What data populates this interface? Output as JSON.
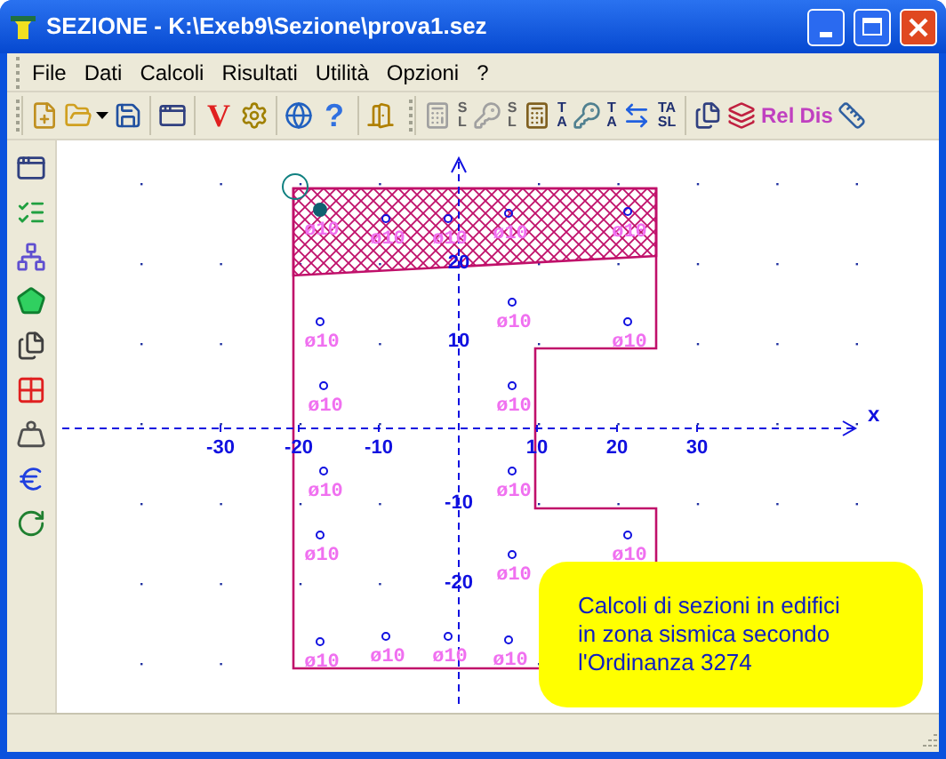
{
  "window": {
    "title": "SEZIONE - K:\\Exeb9\\Sezione\\prova1.sez"
  },
  "menu": [
    "File",
    "Dati",
    "Calcoli",
    "Risultati",
    "Utilità",
    "Opzioni",
    "?"
  ],
  "toolbar": [
    [
      {
        "kind": "new"
      },
      {
        "kind": "open"
      },
      {
        "kind": "dropdown"
      },
      {
        "kind": "save"
      }
    ],
    [
      {
        "kind": "windows"
      }
    ],
    [
      {
        "kind": "text",
        "label": "V"
      },
      {
        "kind": "gear"
      }
    ],
    [
      {
        "kind": "globe"
      },
      {
        "kind": "text",
        "label": "?"
      }
    ],
    [
      {
        "kind": "exit"
      }
    ]
  ],
  "toolbar_2": [
    [
      {
        "kind": "calculator",
        "letters": "SL",
        "disabled": true
      },
      {
        "kind": "key",
        "letters": "SL",
        "disabled": true
      },
      {
        "kind": "calculator",
        "letters": "TA",
        "disabled": false
      },
      {
        "kind": "key",
        "letters": "TA",
        "disabled": false
      },
      {
        "kind": "swap",
        "letters": "TA SL",
        "disabled": false
      }
    ],
    [
      {
        "kind": "pages"
      },
      {
        "kind": "section"
      },
      {
        "kind": "text",
        "label": "Rel"
      },
      {
        "kind": "text",
        "label": "Dis"
      },
      {
        "kind": "ruler"
      }
    ]
  ],
  "side_toolbar": [
    {
      "kind": "windows"
    },
    {
      "kind": "checklist"
    },
    {
      "kind": "network"
    },
    {
      "kind": "pentagon"
    },
    {
      "kind": "rebar"
    },
    {
      "kind": "points"
    },
    {
      "kind": "weight"
    },
    {
      "kind": "euro"
    },
    {
      "kind": "rotate"
    }
  ],
  "canvas": {
    "x_axis": {
      "name": "x",
      "ticks": [
        "-30",
        "-20",
        "-10",
        "10",
        "20",
        "30"
      ]
    },
    "y_axis": {
      "ticks": [
        "20",
        "10",
        "-10",
        "-20"
      ]
    },
    "bars": [
      {
        "label": "ø10",
        "selected": true
      },
      {
        "label": "ø10",
        "selected": false
      },
      {
        "label": "ø10",
        "selected": false
      },
      {
        "label": "ø10",
        "selected": false
      },
      {
        "label": "ø10",
        "selected": false
      },
      {
        "label": "ø10",
        "selected": false
      },
      {
        "label": "ø10",
        "selected": false
      },
      {
        "label": "ø10",
        "selected": false
      },
      {
        "label": "ø10",
        "selected": false
      },
      {
        "label": "ø10",
        "selected": false
      },
      {
        "label": "ø10",
        "selected": false
      },
      {
        "label": "ø10",
        "selected": false
      },
      {
        "label": "ø10",
        "selected": false
      },
      {
        "label": "ø10",
        "selected": false
      },
      {
        "label": "ø10",
        "selected": false
      },
      {
        "label": "ø10",
        "selected": false
      },
      {
        "label": "ø10",
        "selected": false
      },
      {
        "label": "ø10",
        "selected": false
      },
      {
        "label": "ø10",
        "selected": false
      }
    ]
  },
  "note": "Calcoli di sezioni in edifici\nin zona sismica secondo\nl'Ordinanza 3274"
}
